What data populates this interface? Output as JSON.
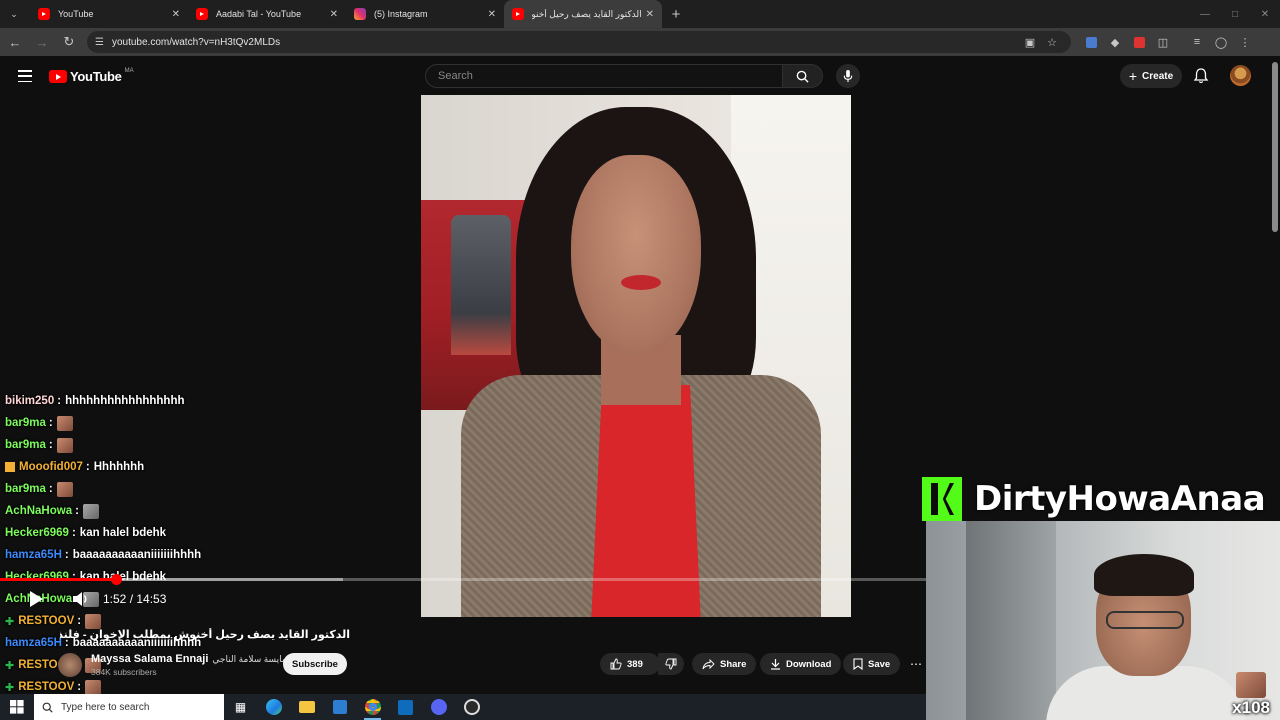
{
  "browser": {
    "tabs": [
      {
        "title": "YouTube",
        "favicon": "youtube-icon",
        "active": false
      },
      {
        "title": "Aadabi Tal - YouTube",
        "favicon": "youtube-icon",
        "active": false
      },
      {
        "title": "(5) Instagram",
        "favicon": "instagram-icon",
        "active": false
      },
      {
        "title": "الدكتور القايد يصف رحيل أخنوش",
        "favicon": "youtube-icon",
        "active": true
      }
    ],
    "new_tab_label": "+",
    "url": "youtube.com/watch?v=nH3tQv2MLDs"
  },
  "youtube": {
    "logo_text": "YouTube",
    "country_code": "MA",
    "search_placeholder": "Search",
    "create_label": "Create"
  },
  "player": {
    "time_display": "1:52 / 14:53",
    "progress_fraction": 0.1255,
    "buffered_fraction": 0.37
  },
  "video": {
    "title": "الدكتور القايد يصف رحيل أخنوش بمطلب الإخوان - فلنذكره بالتاريخ",
    "channel_name": "Mayssa Salama Ennaji",
    "channel_name_ar": "مايسة سلامة الناجي",
    "subscribers": "384K subscribers",
    "subscribe_label": "Subscribe",
    "like_count": "389",
    "share_label": "Share",
    "download_label": "Download",
    "save_label": "Save"
  },
  "chat": {
    "messages": [
      {
        "user": "bikim250",
        "color": "#ffd6d6",
        "text": "hhhhhhhhhhhhhhhhh",
        "emote": false,
        "badge": ""
      },
      {
        "user": "bar9ma",
        "color": "#7cfc5c",
        "text": "",
        "emote": true,
        "badge": ""
      },
      {
        "user": "bar9ma",
        "color": "#7cfc5c",
        "text": "",
        "emote": true,
        "badge": ""
      },
      {
        "user": "Mooofid007",
        "color": "#f2b134",
        "text": "Hhhhhhh",
        "emote": false,
        "badge": "crown"
      },
      {
        "user": "bar9ma",
        "color": "#7cfc5c",
        "text": "",
        "emote": true,
        "badge": ""
      },
      {
        "user": "AchNaHowa",
        "color": "#7cfc5c",
        "text": "",
        "emote": true,
        "badge": ""
      },
      {
        "user": "Hecker6969",
        "color": "#7cfc5c",
        "text": "kan halel bdehk",
        "emote": false,
        "badge": ""
      },
      {
        "user": "hamza65H",
        "color": "#3d8bff",
        "text": "baaaaaaaaaaniiiiiiihhhh",
        "emote": false,
        "badge": ""
      },
      {
        "user": "Hecker6969",
        "color": "#7cfc5c",
        "text": "kan halel bdehk",
        "emote": false,
        "badge": ""
      },
      {
        "user": "AchNaHowa",
        "color": "#7cfc5c",
        "text": "",
        "emote": true,
        "badge": ""
      },
      {
        "user": "RESTOOV",
        "color": "#f2b134",
        "text": "",
        "emote": true,
        "badge": "star"
      },
      {
        "user": "hamza65H",
        "color": "#3d8bff",
        "text": "baaaaaaaaaaniiiiiiihhhh",
        "emote": false,
        "badge": ""
      },
      {
        "user": "RESTOOV",
        "color": "#f2b134",
        "text": "",
        "emote": true,
        "badge": "star"
      },
      {
        "user": "RESTOOV",
        "color": "#f2b134",
        "text": "",
        "emote": true,
        "badge": "star"
      }
    ]
  },
  "stream_overlay": {
    "kick_channel": "DirtyHowaAnaa",
    "multiplier": "x108"
  },
  "taskbar": {
    "search_placeholder": "Type here to search"
  },
  "colors": {
    "youtube_red": "#ff0000",
    "kick_green": "#53fc18"
  }
}
